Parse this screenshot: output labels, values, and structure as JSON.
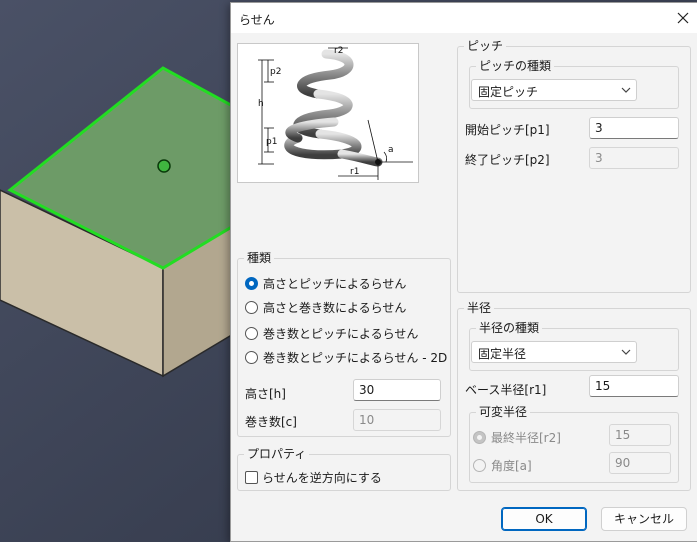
{
  "dialog": {
    "title": "らせん",
    "close_label": "×"
  },
  "diagram": {
    "labels": {
      "r2": "r2",
      "p2": "p2",
      "h": "h",
      "p1": "p1",
      "a": "a",
      "r1": "r1"
    }
  },
  "pitch": {
    "group_label": "ピッチ",
    "type_group_label": "ピッチの種類",
    "type_selected": "固定ピッチ",
    "start_label": "開始ピッチ[p1]",
    "start_value": "3",
    "end_label": "終了ピッチ[p2]",
    "end_value": "3"
  },
  "kind": {
    "group_label": "種類",
    "options": [
      {
        "label": "高さとピッチによるらせん",
        "checked": true
      },
      {
        "label": "高さと巻き数によるらせん",
        "checked": false
      },
      {
        "label": "巻き数とピッチによるらせん",
        "checked": false
      },
      {
        "label": "巻き数とピッチによるらせん - 2D",
        "checked": false
      }
    ],
    "height_label": "高さ[h]",
    "height_value": "30",
    "turns_label": "巻き数[c]",
    "turns_value": "10"
  },
  "properties": {
    "group_label": "プロパティ",
    "reverse_label": "らせんを逆方向にする",
    "reverse_checked": false
  },
  "radius": {
    "group_label": "半径",
    "type_group_label": "半径の種類",
    "type_selected": "固定半径",
    "base_label": "ベース半径[r1]",
    "base_value": "15",
    "variable_group_label": "可変半径",
    "final_label": "最終半径[r2]",
    "final_value": "15",
    "angle_label": "角度[a]",
    "angle_value": "90"
  },
  "buttons": {
    "ok": "OK",
    "cancel": "キャンセル"
  },
  "colors": {
    "viewport_bg": "#3d4456",
    "face_top": "#6d9b67",
    "face_side": "#c4b9a3",
    "edge_highlight": "#22dd22",
    "accent": "#0067c0"
  }
}
